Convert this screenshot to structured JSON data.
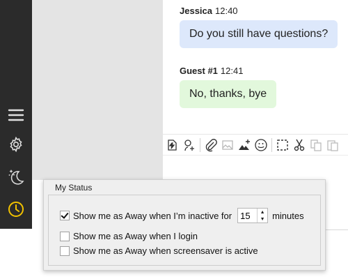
{
  "colors": {
    "sidebar_bg": "#2b2b2b",
    "sidebar_icon": "#e0e0e0",
    "status_icon": "#f2c200",
    "own_bubble": "#dde8fb",
    "guest_bubble": "#e2f8dc",
    "pane_bg": "#e4e4e4"
  },
  "sidebar": {
    "icons": [
      "menu-icon",
      "gear-icon",
      "moon-stars-icon",
      "clock-icon"
    ]
  },
  "chat": {
    "messages": [
      {
        "sender": "Jessica",
        "time": "12:40",
        "text": "Do you still have questions?"
      },
      {
        "sender": "Guest #1",
        "time": "12:41",
        "text": "No, thanks, bye"
      }
    ]
  },
  "toolbar": {
    "icons": [
      "transfer-file-icon",
      "invite-user-icon",
      "attach-icon",
      "image-icon",
      "image-add-icon",
      "smiley-icon",
      "select-area-icon",
      "cut-icon",
      "copy-icon",
      "paste-icon"
    ]
  },
  "status_panel": {
    "title": "My Status",
    "inactive_option": {
      "label_before": "Show me as Away when I’m inactive for",
      "value": "15",
      "label_after": "minutes",
      "checked": true
    },
    "login_option": {
      "label": "Show me as Away when I login",
      "checked": false
    },
    "screensaver_option": {
      "label": "Show me as Away when screensaver is active",
      "checked": false
    }
  }
}
